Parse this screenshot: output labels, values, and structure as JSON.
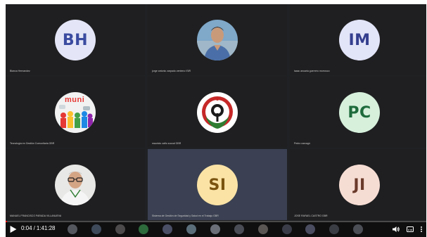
{
  "tiles": [
    {
      "type": "initials",
      "initials": "BH",
      "color": "blue",
      "name": "Blanca Hernandez"
    },
    {
      "type": "photo",
      "photo_icon": "person-photo-icon",
      "name": "jorge antonio zarpado zenteno ISIR"
    },
    {
      "type": "initials",
      "initials": "IM",
      "color": "lav",
      "name": "isaac anuaria  guerrero morrosco"
    },
    {
      "type": "image",
      "image_icon": "community-people-icon",
      "image_text": "muni",
      "name": "Tecnología en Gestión Comunitaria GBR"
    },
    {
      "type": "image",
      "image_icon": "institution-seal-icon",
      "name": "mauricio zaño zuccal GBR"
    },
    {
      "type": "initials",
      "initials": "PC",
      "color": "green",
      "name": "Pedro carcagú"
    },
    {
      "type": "photo",
      "photo_icon": "man-glasses-photo-icon",
      "name": "MANUEL FRANCISCO PARADA VILLANUEVA"
    },
    {
      "type": "initials",
      "initials": "SI",
      "color": "yellow",
      "name": "Sistema de Gestión de Seguridad y Salud en el Trabajo GBR"
    },
    {
      "type": "initials",
      "initials": "JI",
      "color": "peach",
      "name": "JOSE RAFAEL CASTRO GBR"
    }
  ],
  "player": {
    "current_time": "0:04",
    "separator": "/",
    "duration": "1:41:28",
    "progress_fraction": 0.0007,
    "accent_color": "#ff0000",
    "play_icon": "play-icon",
    "volume_icon": "volume-icon",
    "cc_icon": "subtitles-icon",
    "more_icon": "more-vert-icon"
  },
  "strip": [
    {
      "label": "",
      "bg": "#55575e"
    },
    {
      "label": "",
      "bg": "#3e4a5a"
    },
    {
      "label": "",
      "bg": "#4c4a4a"
    },
    {
      "label": "",
      "bg": "#2d6a3c"
    },
    {
      "label": "",
      "bg": "#4a4f66"
    },
    {
      "label": "",
      "bg": "#5a6e7a"
    },
    {
      "label": "",
      "bg": "#6a6f78"
    },
    {
      "label": "",
      "bg": "#4a4c55"
    },
    {
      "label": "",
      "bg": "#5a5654"
    },
    {
      "label": "",
      "bg": "#3a3c48"
    },
    {
      "label": "",
      "bg": "#4a4d60"
    },
    {
      "label": "",
      "bg": "#3b3d44"
    },
    {
      "label": "",
      "bg": "#4c4e56"
    }
  ]
}
